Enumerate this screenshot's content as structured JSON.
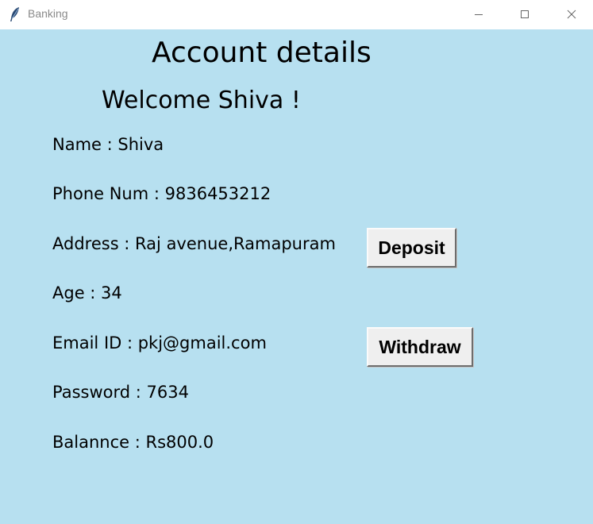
{
  "window": {
    "title": "Banking",
    "icon": "feather-icon",
    "controls": [
      "minimize-icon",
      "maximize-icon",
      "close-icon"
    ]
  },
  "page": {
    "title": "Account details",
    "welcome": "Welcome Shiva !"
  },
  "fields": {
    "name": "Name : Shiva",
    "phone": "Phone Num :  9836453212",
    "address": "Address : Raj avenue,Ramapuram",
    "age": "Age : 34",
    "email": "Email ID : pkj@gmail.com",
    "password": "Password : 7634",
    "balance": "Balannce : Rs800.0"
  },
  "buttons": {
    "deposit": "Deposit",
    "withdraw": "Withdraw"
  },
  "colors": {
    "background": "#b7e0f0",
    "titlebar": "#ffffff",
    "button_face": "#efefef"
  }
}
